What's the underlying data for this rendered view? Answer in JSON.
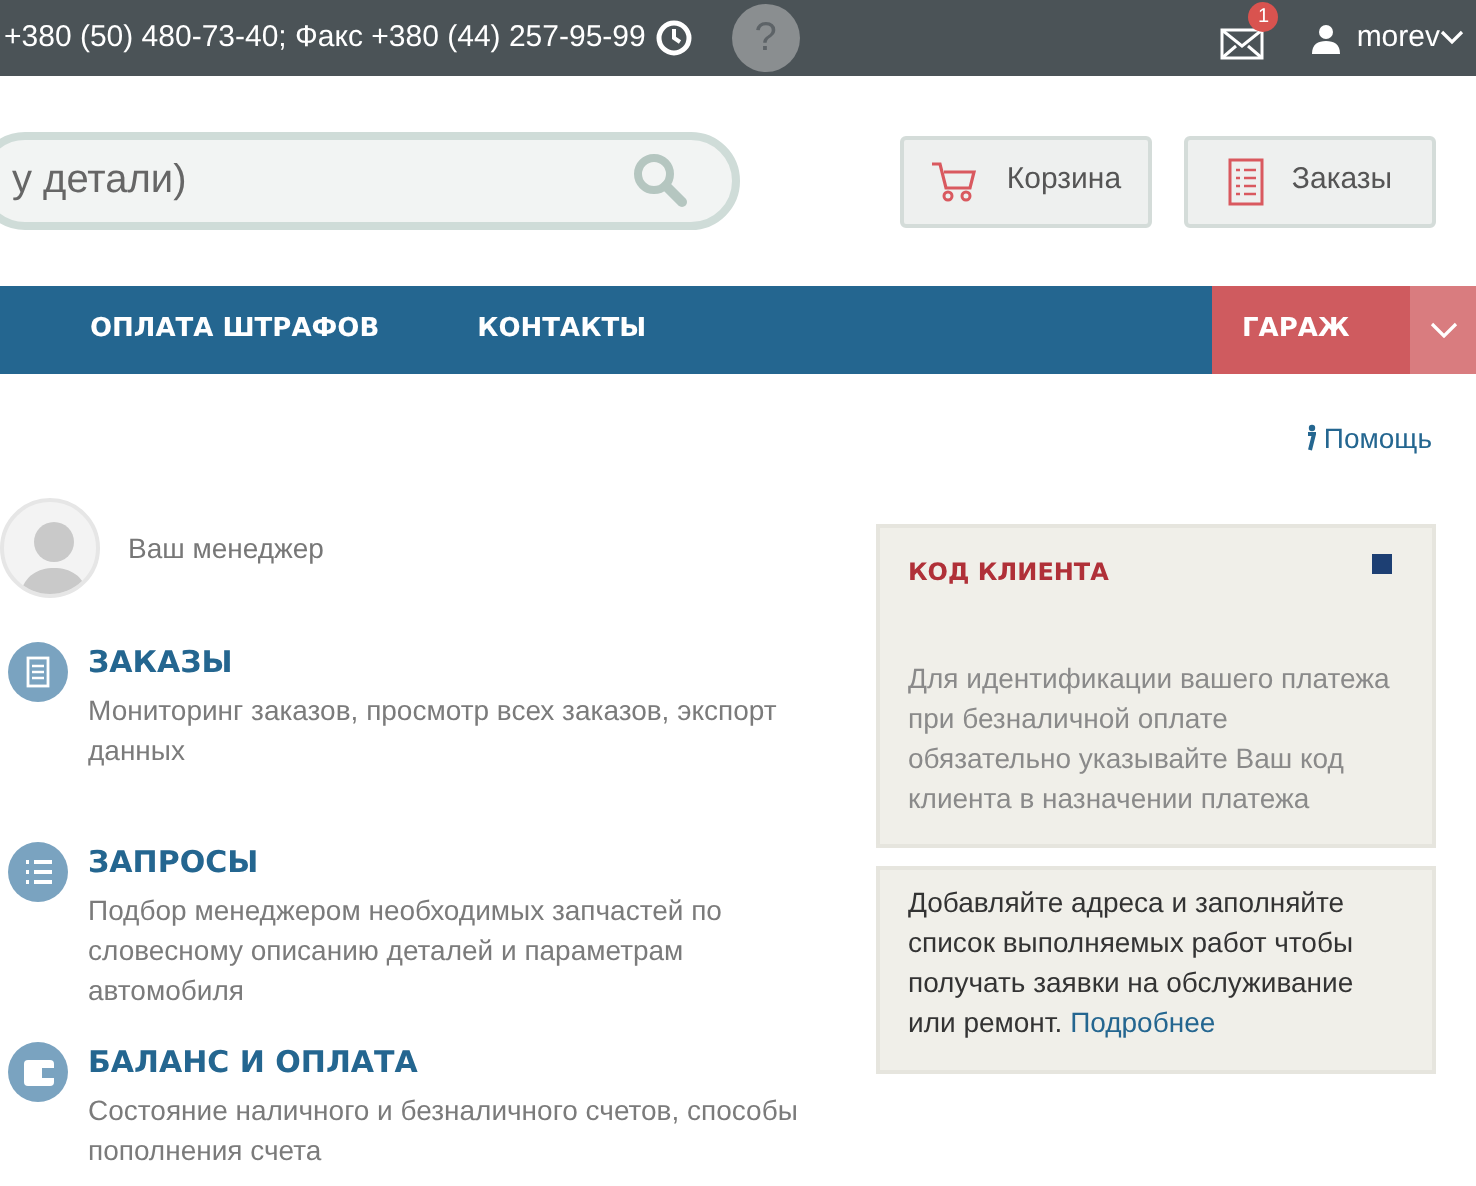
{
  "top_bar": {
    "contacts": "+380 (50) 480-73-40; Факс +380 (44) 257-95-99",
    "help_button": "?",
    "messages_badge": "1",
    "user": "morev"
  },
  "search": {
    "placeholder": "у детали)"
  },
  "header_buttons": [
    {
      "label": "Корзина",
      "kind": "cart"
    },
    {
      "label": "Заказы",
      "kind": "orders"
    }
  ],
  "nav": {
    "items": [
      {
        "label": "ОПЛАТА ШТРАФОВ"
      },
      {
        "label": "КОНТАКТЫ"
      }
    ],
    "garage": "ГАРАЖ"
  },
  "help_link": "Помощь",
  "manager": {
    "label": "Ваш менеджер"
  },
  "sections": [
    {
      "kind": "orders",
      "title": "ЗАКАЗЫ",
      "text": "Мониторинг заказов, просмотр всех заказов, экспорт данных"
    },
    {
      "kind": "requests",
      "title": "ЗАПРОСЫ",
      "text": "Подбор менеджером необходимых запчастей по словесному описанию деталей и параметрам автомобиля"
    },
    {
      "kind": "balance",
      "title": "БАЛАНС И ОПЛАТА",
      "text": "Состояние наличного и безналичного счетов, способы пополнения счета"
    }
  ],
  "client_code": {
    "title": "КОД КЛИЕНТА",
    "text": "Для идентификации вашего платежа при безналичной оплате обязательно указывайте Ваш код клиента в назначении платежа"
  },
  "garage_info": {
    "text": "Добавляйте адреса и заполняйте список выполняемых работ чтобы получать заявки на обслуживание или ремонт.",
    "link": "Подробнее"
  }
}
